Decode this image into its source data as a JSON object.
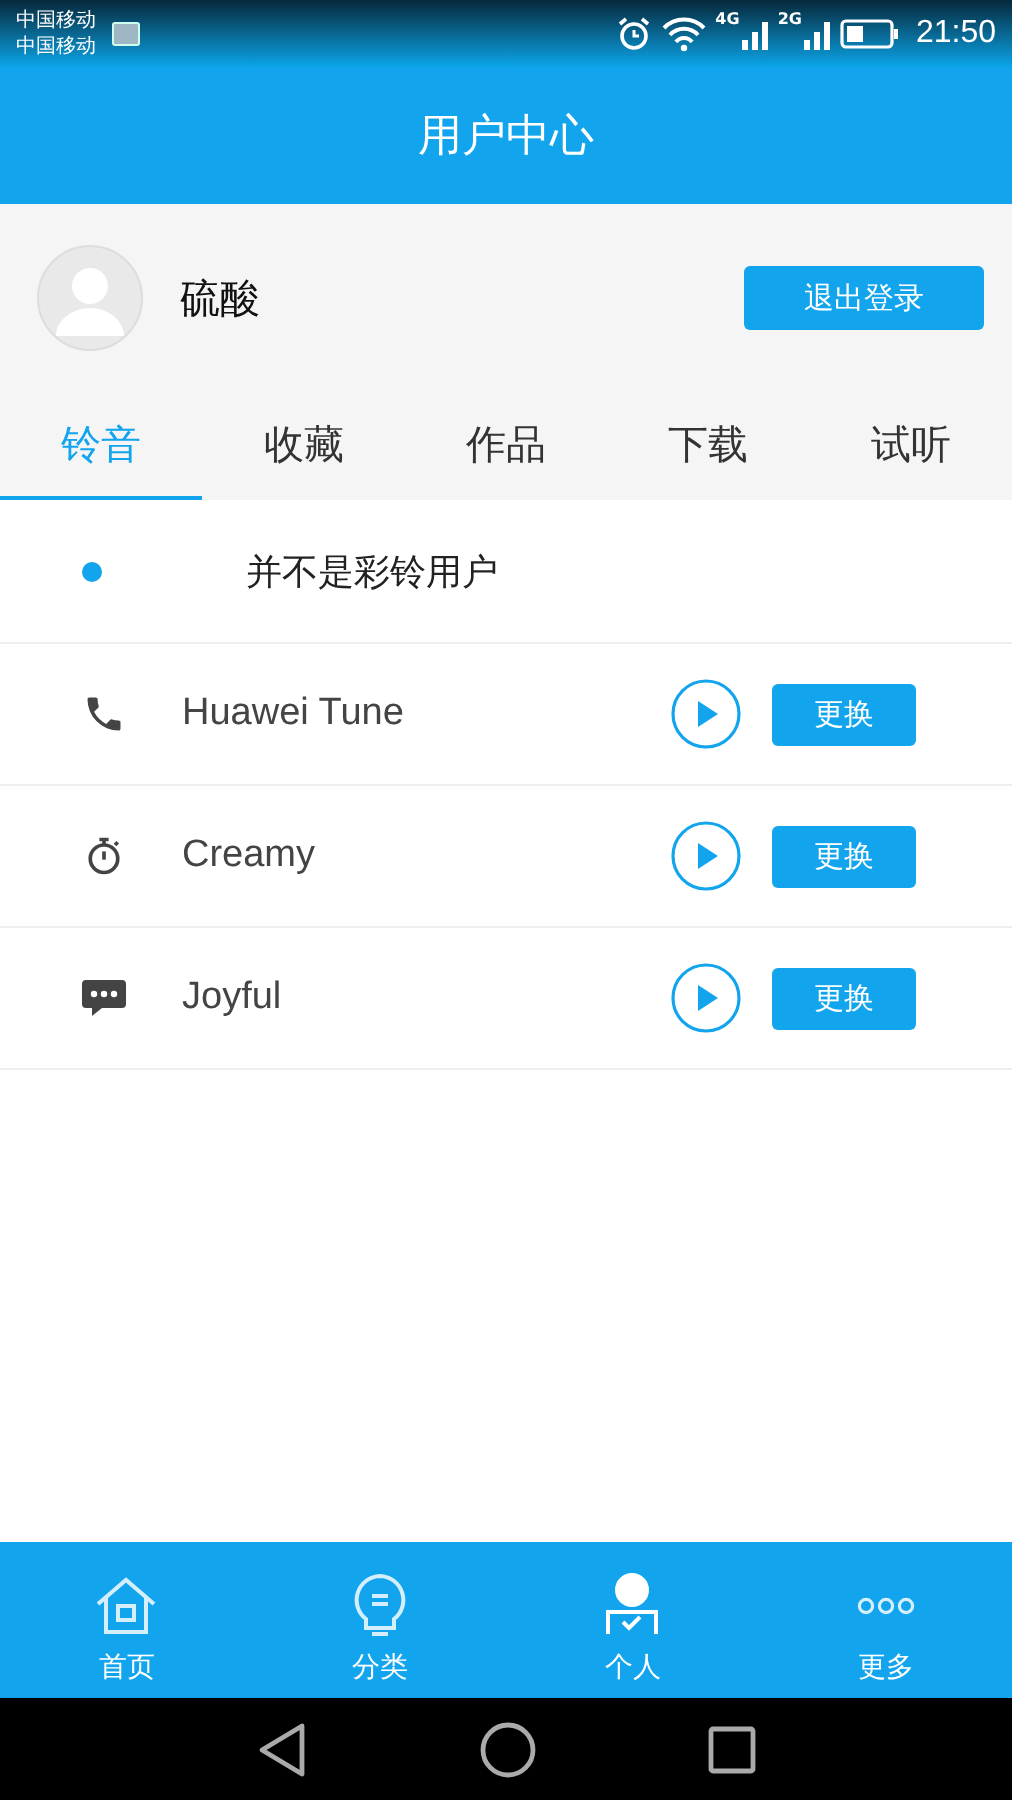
{
  "status_bar": {
    "carriers": [
      "中国移动",
      "中国移动"
    ],
    "network_1": "4G",
    "network_2": "2G",
    "time": "21:50"
  },
  "header": {
    "title": "用户中心"
  },
  "profile": {
    "name": "硫酸",
    "logout_button": "退出登录"
  },
  "tabs": [
    {
      "label": "铃音",
      "selected": true
    },
    {
      "label": "收藏",
      "selected": false
    },
    {
      "label": "作品",
      "selected": false
    },
    {
      "label": "下载",
      "selected": false
    },
    {
      "label": "试听",
      "selected": false
    }
  ],
  "notice": "并不是彩铃用户",
  "ringtones": [
    {
      "kind": "phone",
      "name": "Huawei Tune",
      "button": "更换"
    },
    {
      "kind": "timer",
      "name": "Creamy",
      "button": "更换"
    },
    {
      "kind": "chat",
      "name": "Joyful",
      "button": "更换"
    }
  ],
  "bottom_nav": [
    {
      "kind": "home",
      "label": "首页",
      "selected": false
    },
    {
      "kind": "category",
      "label": "分类",
      "selected": false
    },
    {
      "kind": "person",
      "label": "个人",
      "selected": true
    },
    {
      "kind": "more",
      "label": "更多",
      "selected": false
    }
  ]
}
